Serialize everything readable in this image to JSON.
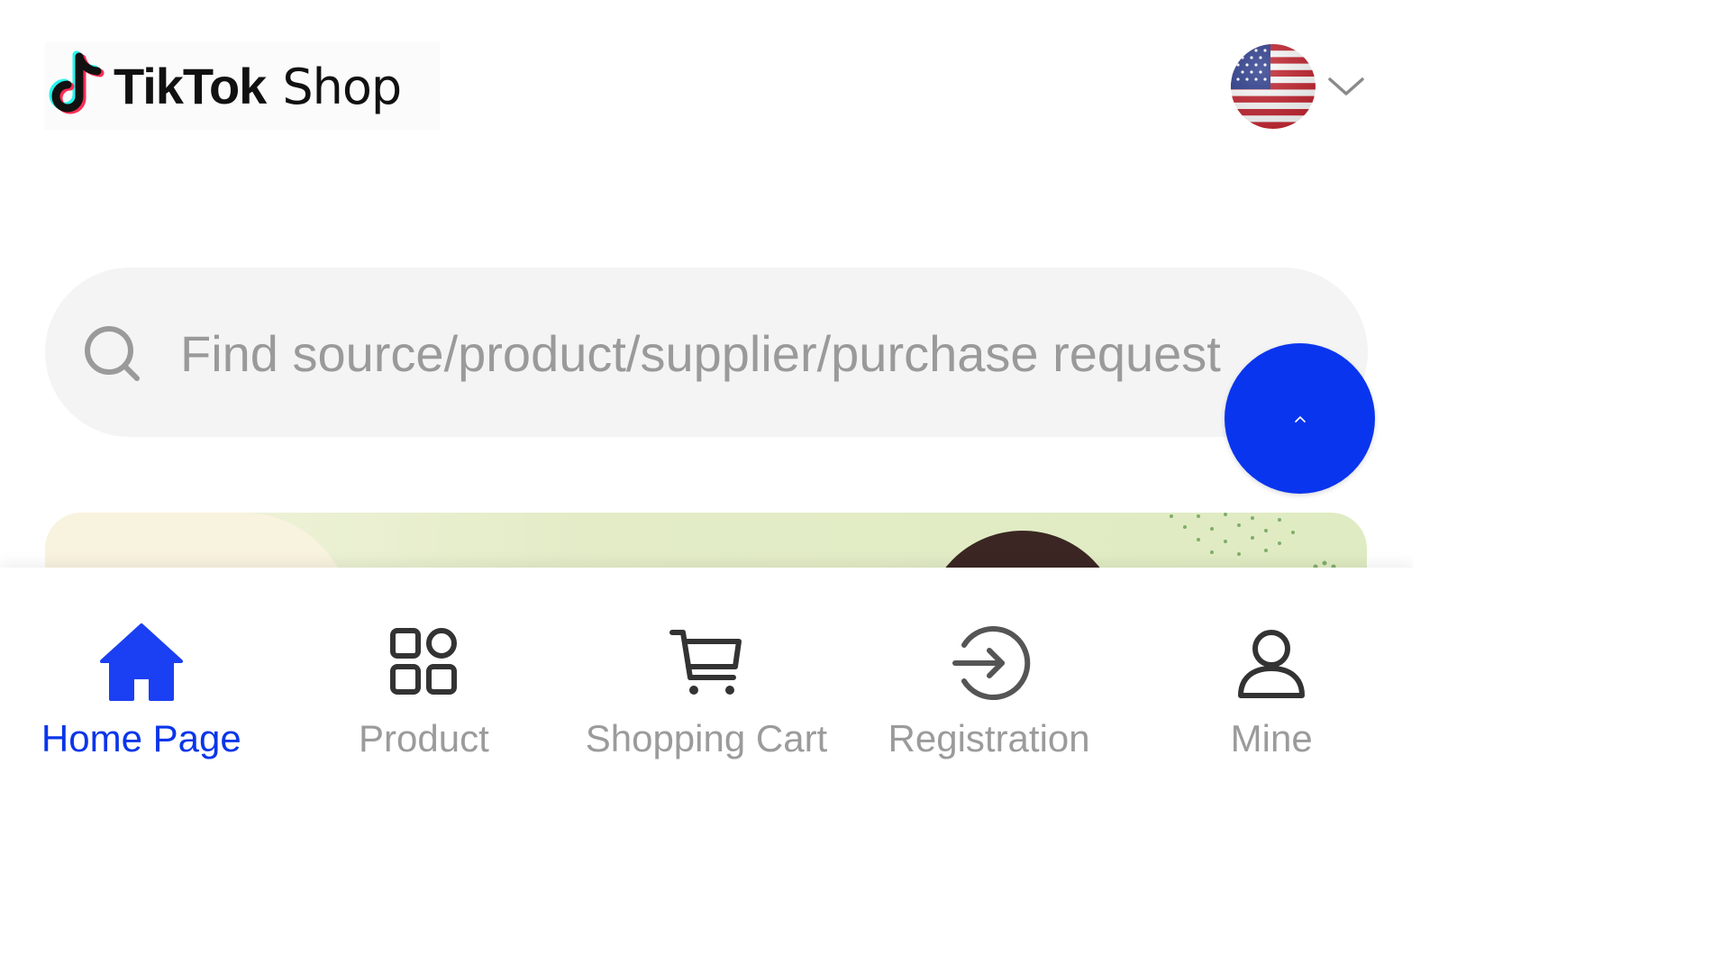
{
  "header": {
    "logo": {
      "brand": "TikTok",
      "suffix": "Shop"
    },
    "language_selector": {
      "flag": "us-flag-icon",
      "chevron": "chevron-down-icon"
    }
  },
  "search": {
    "placeholder": "Find source/product/supplier/purchase request",
    "value": "",
    "icon": "search-icon"
  },
  "fab": {
    "icon": "chevron-up-icon",
    "color": "#0a35ee"
  },
  "bottom_nav": {
    "items": [
      {
        "label": "Home Page",
        "icon": "home-icon",
        "active": true
      },
      {
        "label": "Product",
        "icon": "grid-icon",
        "active": false
      },
      {
        "label": "Shopping Cart",
        "icon": "cart-icon",
        "active": false
      },
      {
        "label": "Registration",
        "icon": "login-arrow-icon",
        "active": false
      },
      {
        "label": "Mine",
        "icon": "user-icon",
        "active": false
      }
    ],
    "active_color": "#0a35ea",
    "inactive_color": "#9b9b9b"
  }
}
